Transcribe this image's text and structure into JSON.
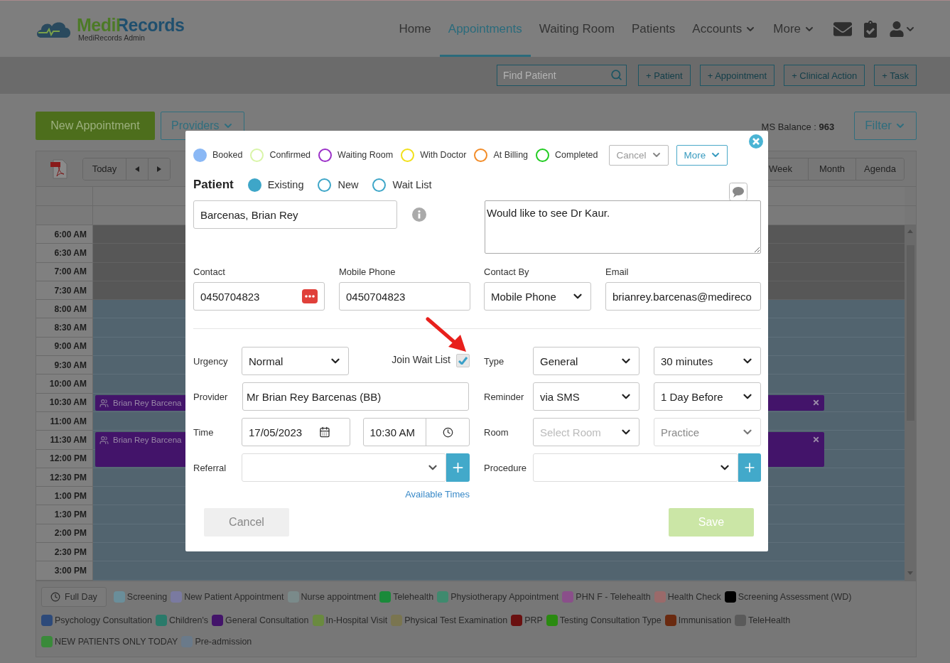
{
  "header": {
    "logo": {
      "name": "MediRecords",
      "subtitle": "MediRecords Admin"
    },
    "nav": [
      {
        "label": "Home",
        "selected": false,
        "dropdown": false
      },
      {
        "label": "Appointments",
        "selected": true,
        "dropdown": false
      },
      {
        "label": "Waiting Room",
        "selected": false,
        "dropdown": false
      },
      {
        "label": "Patients",
        "selected": false,
        "dropdown": false
      },
      {
        "label": "Accounts",
        "selected": false,
        "dropdown": true
      },
      {
        "label": "More",
        "selected": false,
        "dropdown": true
      }
    ]
  },
  "toolbar": {
    "search": {
      "placeholder": "Find Patient"
    },
    "buttons": [
      "+ Patient",
      "+ Appointment",
      "+ Clinical Action",
      "+ Task"
    ]
  },
  "actions": {
    "new_appointment": "New Appointment",
    "providers": "Providers",
    "sms_balance": {
      "label": "MS Balance :",
      "value": "963"
    },
    "filter": "Filter"
  },
  "calendar": {
    "today": "Today",
    "views": [
      {
        "label": "Week",
        "selected": false
      },
      {
        "label": "Month",
        "selected": false
      },
      {
        "label": "Agenda",
        "selected": false
      }
    ],
    "slots": [
      {
        "time": "6:00 AM",
        "closed": true
      },
      {
        "time": "6:30 AM",
        "closed": true
      },
      {
        "time": "7:00 AM",
        "closed": true
      },
      {
        "time": "7:30 AM",
        "closed": true
      },
      {
        "time": "8:00 AM",
        "closed": false
      },
      {
        "time": "8:30 AM",
        "closed": false
      },
      {
        "time": "9:00 AM",
        "closed": false
      },
      {
        "time": "9:30 AM",
        "closed": false
      },
      {
        "time": "10:00 AM",
        "closed": false
      },
      {
        "time": "10:30 AM",
        "closed": false,
        "appointment": {
          "title": "Brian Rey Barcena",
          "kind": "short"
        }
      },
      {
        "time": "11:00 AM",
        "closed": false
      },
      {
        "time": "11:30 AM",
        "closed": false,
        "appointment": {
          "title": "Brian Rey Barcena",
          "kind": "long"
        }
      },
      {
        "time": "12:00 PM",
        "closed": false
      },
      {
        "time": "12:30 PM",
        "closed": false
      },
      {
        "time": "1:00 PM",
        "closed": false
      },
      {
        "time": "1:30 PM",
        "closed": false
      },
      {
        "time": "2:00 PM",
        "closed": false
      },
      {
        "time": "2:30 PM",
        "closed": false
      },
      {
        "time": "3:00 PM",
        "closed": false
      }
    ],
    "full_day": "Full Day",
    "legend": [
      {
        "label": "Screening",
        "color": "#6a8e9a"
      },
      {
        "label": "New Patient Appointment",
        "color": "#7a7aa0"
      },
      {
        "label": "Nurse appointment",
        "color": "#7a8a8a"
      },
      {
        "label": "Telehealth",
        "color": "#1a8a3a"
      },
      {
        "label": "Physiotherapy Appointment",
        "color": "#3f8a6e"
      },
      {
        "label": "PHN F - Telehealth",
        "color": "#8a4f8a"
      },
      {
        "label": "Health Check",
        "color": "#9a6a6a"
      },
      {
        "label": "Screening Assessment (WD)",
        "color": "#000000"
      },
      {
        "label": "Psychology Consultation",
        "color": "#2d4a7a"
      },
      {
        "label": "Children's",
        "color": "#2a7a6a"
      },
      {
        "label": "General Consultation",
        "color": "#43146a"
      },
      {
        "label": "In-Hospital Visit",
        "color": "#6a8a3f"
      },
      {
        "label": "Physical Test Examination",
        "color": "#7a7550"
      },
      {
        "label": "PRP",
        "color": "#6a1010"
      },
      {
        "label": "Testing Consultation Type",
        "color": "#2a8a10"
      },
      {
        "label": "Immunisation",
        "color": "#6a2a10"
      },
      {
        "label": "TeleHealth",
        "color": "#5a5a5a"
      },
      {
        "label": "NEW PATIENTS ONLY TODAY",
        "color": "#3a8a3a"
      },
      {
        "label": "Pre-admission",
        "color": "#6a7a8a"
      }
    ]
  },
  "modal": {
    "statuses": [
      {
        "label": "Booked",
        "color": "#8ab8f5",
        "selected": true
      },
      {
        "label": "Confirmed",
        "color": "#d9f5a8",
        "selected": false
      },
      {
        "label": "Waiting Room",
        "color": "#9b30c8",
        "selected": false
      },
      {
        "label": "With Doctor",
        "color": "#f2e01a",
        "selected": false
      },
      {
        "label": "At Billing",
        "color": "#f28c28",
        "selected": false
      },
      {
        "label": "Completed",
        "color": "#22cc22",
        "selected": false
      }
    ],
    "cancel_menu": "Cancel",
    "more_menu": "More",
    "patient": {
      "label": "Patient",
      "options": [
        {
          "label": "Existing",
          "selected": true
        },
        {
          "label": "New",
          "selected": false
        },
        {
          "label": "Wait List",
          "selected": false
        }
      ],
      "name": "Barcenas, Brian Rey",
      "notes": "Would like to see Dr Kaur."
    },
    "contact": [
      {
        "label": "Contact",
        "value": "0450704823",
        "kind": "phone"
      },
      {
        "label": "Mobile Phone",
        "value": "0450704823",
        "kind": "text"
      },
      {
        "label": "Contact By",
        "value": "Mobile Phone",
        "kind": "select"
      },
      {
        "label": "Email",
        "value": "brianrey.barcenas@medireco",
        "kind": "text"
      }
    ],
    "urgency": {
      "label": "Urgency",
      "value": "Normal"
    },
    "join_wait_list": {
      "label": "Join Wait List",
      "checked": true
    },
    "provider": {
      "label": "Provider",
      "value": "Mr Brian Rey Barcenas (BB)"
    },
    "time": {
      "label": "Time",
      "date": "17/05/2023",
      "time": "10:30 AM"
    },
    "referral": {
      "label": "Referral"
    },
    "available_times": "Available Times",
    "type": {
      "label": "Type",
      "value": "General",
      "duration": "30 minutes"
    },
    "reminder": {
      "label": "Reminder",
      "value": "via SMS",
      "when": "1 Day Before"
    },
    "room": {
      "label": "Room",
      "placeholder": "Select Room",
      "practice": "Practice"
    },
    "procedure": {
      "label": "Procedure"
    },
    "buttons": {
      "cancel": "Cancel",
      "save": "Save",
      "save_disabled": true
    }
  }
}
